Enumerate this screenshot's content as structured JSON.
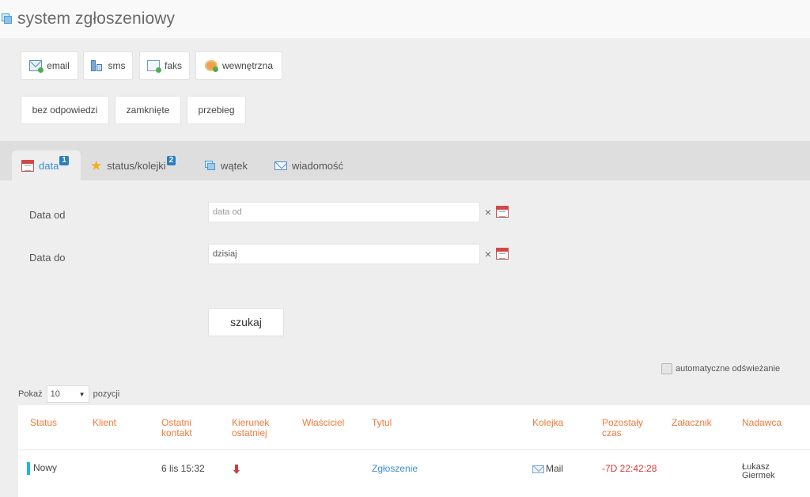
{
  "header": {
    "title": "system zgłoszeniowy"
  },
  "toolbar": {
    "channels": [
      {
        "label": "email",
        "icon": "email-icon"
      },
      {
        "label": "sms",
        "icon": "sms-icon"
      },
      {
        "label": "faks",
        "icon": "fax-icon"
      },
      {
        "label": "wewnętrzna",
        "icon": "internal-icon"
      }
    ],
    "filters": [
      {
        "label": "bez odpowiedzi"
      },
      {
        "label": "zamknięte"
      },
      {
        "label": "przebieg"
      }
    ]
  },
  "tabs": [
    {
      "label": "data",
      "badge": "1",
      "active": true,
      "icon": "calendar-icon"
    },
    {
      "label": "status/kolejki",
      "badge": "2",
      "active": false,
      "icon": "star-icon"
    },
    {
      "label": "wątek",
      "badge": "",
      "active": false,
      "icon": "thread-icon"
    },
    {
      "label": "wiadomość",
      "badge": "",
      "active": false,
      "icon": "envelope-icon"
    }
  ],
  "form": {
    "date_from_label": "Data od",
    "date_from_placeholder": "data od",
    "date_from_value": "",
    "date_to_label": "Data do",
    "date_to_value": "dzisiaj",
    "search_label": "szukaj",
    "clear_symbol": "×"
  },
  "auto_refresh": {
    "label": "automatyczne odświeżanie",
    "checked": false
  },
  "paging": {
    "show_label": "Pokaż",
    "page_size": "10",
    "positions_label": "pozycji"
  },
  "table": {
    "columns": {
      "status": "Status",
      "client": "Klient",
      "last_contact_1": "Ostatni",
      "last_contact_2": "kontakt",
      "direction_1": "Kierunek",
      "direction_2": "ostatniej",
      "owner": "Właściciel",
      "title": "Tytul",
      "queue": "Kolejka",
      "remaining_1": "Pozostały",
      "remaining_2": "czas",
      "attachment": "Załacznik",
      "sender": "Nadawca"
    },
    "rows": [
      {
        "status": "Nowy",
        "client": "",
        "last_contact": "6 lis 15:32",
        "direction": "down",
        "owner": "",
        "title": "Zgłoszenie",
        "queue": "Mail",
        "remaining": "-7D 22:42:28",
        "attachment": "",
        "sender_1": "Łukasz",
        "sender_2": "Giermek"
      }
    ]
  },
  "colors": {
    "accent_blue": "#3a8fd0",
    "header_orange": "#f07a3c",
    "status_new": "#19b4e8",
    "negative_red": "#d63a3a"
  }
}
